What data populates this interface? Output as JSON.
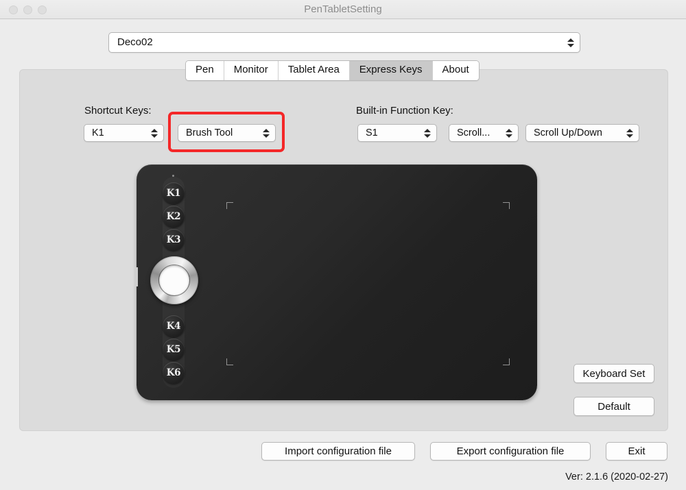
{
  "window": {
    "title": "PenTabletSetting",
    "traffic_lights": [
      "close-button",
      "minimize-button",
      "zoom-button"
    ]
  },
  "device_selector": {
    "value": "Deco02",
    "icon": "stepper-updown-icon"
  },
  "tabs": [
    {
      "label": "Pen",
      "active": false
    },
    {
      "label": "Monitor",
      "active": false
    },
    {
      "label": "Tablet Area",
      "active": false
    },
    {
      "label": "Express Keys",
      "active": true
    },
    {
      "label": "About",
      "active": false
    }
  ],
  "shortcut_keys": {
    "label": "Shortcut Keys:",
    "key_select": {
      "value": "K1"
    },
    "action_select": {
      "value": "Brush Tool",
      "highlighted": true,
      "highlight_color": "#f42728"
    }
  },
  "builtin_function_key": {
    "label": "Built-in Function Key:",
    "key_select": {
      "value": "S1"
    },
    "mode_select": {
      "value": "Scroll..."
    },
    "action_select": {
      "value": "Scroll Up/Down"
    }
  },
  "tablet": {
    "name": "deco02-tablet-illustration",
    "express_keys": [
      "K1",
      "K2",
      "K3",
      "K4",
      "K5",
      "K6"
    ],
    "dial": "ring-dial",
    "led": "status-led"
  },
  "side_buttons": {
    "keyboard_set": "Keyboard Set",
    "default": "Default"
  },
  "footer_buttons": {
    "import": "Import configuration file",
    "export": "Export configuration file",
    "exit": "Exit"
  },
  "version_text": "Ver: 2.1.6 (2020-02-27)"
}
